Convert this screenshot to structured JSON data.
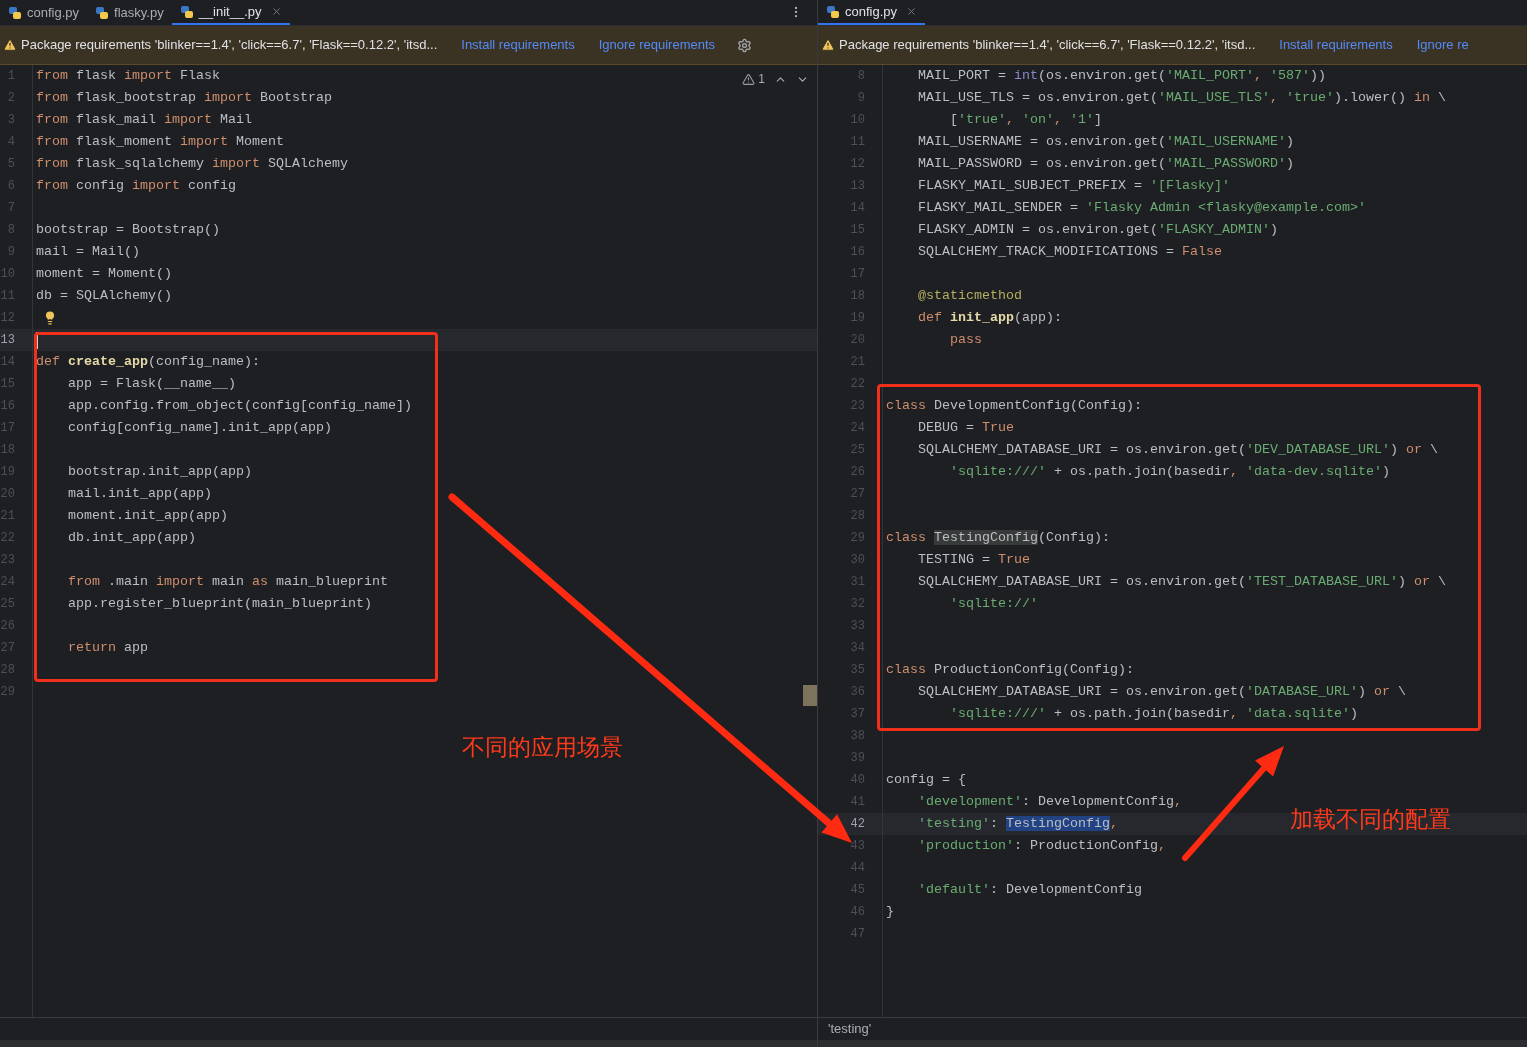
{
  "panes": [
    {
      "tabs": [
        {
          "label": "config.py",
          "selected": false
        },
        {
          "label": "flasky.py",
          "selected": false
        },
        {
          "label": "__init__.py",
          "selected": true
        }
      ],
      "banner": {
        "message": "Package requirements 'blinker==1.4', 'click==6.7', 'Flask==0.12.2', 'itsd...",
        "actions": [
          "Install requirements",
          "Ignore requirements"
        ],
        "settings": true
      },
      "inspections": {
        "count": "1"
      },
      "caret": true,
      "lines": [
        {
          "n": "1",
          "current": false,
          "segs": [
            {
              "text": "from",
              "kind": "kw"
            },
            {
              "text": " flask ",
              "kind": "plain"
            },
            {
              "text": "import",
              "kind": "kw"
            },
            {
              "text": " Flask",
              "kind": "plain"
            }
          ]
        },
        {
          "n": "2",
          "current": false,
          "segs": [
            {
              "text": "from",
              "kind": "kw"
            },
            {
              "text": " flask_bootstrap ",
              "kind": "plain"
            },
            {
              "text": "import",
              "kind": "kw"
            },
            {
              "text": " Bootstrap",
              "kind": "plain"
            }
          ]
        },
        {
          "n": "3",
          "current": false,
          "segs": [
            {
              "text": "from",
              "kind": "kw"
            },
            {
              "text": " flask_mail ",
              "kind": "plain"
            },
            {
              "text": "import",
              "kind": "kw"
            },
            {
              "text": " Mail",
              "kind": "plain"
            }
          ]
        },
        {
          "n": "4",
          "current": false,
          "segs": [
            {
              "text": "from",
              "kind": "kw"
            },
            {
              "text": " flask_moment ",
              "kind": "plain"
            },
            {
              "text": "import",
              "kind": "kw"
            },
            {
              "text": " Moment",
              "kind": "plain"
            }
          ]
        },
        {
          "n": "5",
          "current": false,
          "segs": [
            {
              "text": "from",
              "kind": "kw"
            },
            {
              "text": " flask_sqlalchemy ",
              "kind": "plain"
            },
            {
              "text": "import",
              "kind": "kw"
            },
            {
              "text": " SQLAlchemy",
              "kind": "plain"
            }
          ]
        },
        {
          "n": "6",
          "current": false,
          "segs": [
            {
              "text": "from",
              "kind": "kw"
            },
            {
              "text": " config ",
              "kind": "plain"
            },
            {
              "text": "import",
              "kind": "kw"
            },
            {
              "text": " config",
              "kind": "plain"
            }
          ]
        },
        {
          "n": "7",
          "current": false
        },
        {
          "n": "8",
          "current": false,
          "segs": [
            {
              "text": "bootstrap = Bootstrap()",
              "kind": "plain"
            }
          ]
        },
        {
          "n": "9",
          "current": false,
          "segs": [
            {
              "text": "mail = Mail()",
              "kind": "plain"
            }
          ]
        },
        {
          "n": "10",
          "current": false,
          "segs": [
            {
              "text": "moment = Moment()",
              "kind": "plain"
            }
          ]
        },
        {
          "n": "11",
          "current": false,
          "segs": [
            {
              "text": "db = SQLAlchemy()",
              "kind": "plain"
            }
          ]
        },
        {
          "n": "12",
          "current": false,
          "hint": true
        },
        {
          "n": "13",
          "current": true
        },
        {
          "n": "14",
          "current": false,
          "segs": [
            {
              "text": "def ",
              "kind": "kw"
            },
            {
              "text": "create_app",
              "kind": "fn"
            },
            {
              "text": "(config_name):",
              "kind": "plain"
            }
          ]
        },
        {
          "n": "15",
          "current": false,
          "segs": [
            {
              "text": "    app = Flask(__name__)",
              "kind": "plain"
            }
          ]
        },
        {
          "n": "16",
          "current": false,
          "segs": [
            {
              "text": "    app.config.from_object(config[config_name])",
              "kind": "plain"
            }
          ]
        },
        {
          "n": "17",
          "current": false,
          "segs": [
            {
              "text": "    config[config_name].init_app(app)",
              "kind": "plain"
            }
          ]
        },
        {
          "n": "18",
          "current": false
        },
        {
          "n": "19",
          "current": false,
          "segs": [
            {
              "text": "    bootstrap.init_app(app)",
              "kind": "plain"
            }
          ]
        },
        {
          "n": "20",
          "current": false,
          "segs": [
            {
              "text": "    mail.init_app(app)",
              "kind": "plain"
            }
          ]
        },
        {
          "n": "21",
          "current": false,
          "segs": [
            {
              "text": "    moment.init_app(app)",
              "kind": "plain"
            }
          ]
        },
        {
          "n": "22",
          "current": false,
          "segs": [
            {
              "text": "    db.init_app(app)",
              "kind": "plain"
            }
          ]
        },
        {
          "n": "23",
          "current": false
        },
        {
          "n": "24",
          "current": false,
          "segs": [
            {
              "text": "    from",
              "kind": "kw"
            },
            {
              "text": " .main ",
              "kind": "plain"
            },
            {
              "text": "import",
              "kind": "kw"
            },
            {
              "text": " main ",
              "kind": "plain"
            },
            {
              "text": "as",
              "kind": "kw"
            },
            {
              "text": " main_blueprint",
              "kind": "plain"
            }
          ]
        },
        {
          "n": "25",
          "current": false,
          "segs": [
            {
              "text": "    app.register_blueprint(main_blueprint)",
              "kind": "plain"
            }
          ]
        },
        {
          "n": "26",
          "current": false
        },
        {
          "n": "27",
          "current": false,
          "segs": [
            {
              "text": "    return",
              "kind": "kw"
            },
            {
              "text": " app",
              "kind": "plain"
            }
          ]
        },
        {
          "n": "28",
          "current": false
        },
        {
          "n": "29",
          "current": false
        }
      ]
    },
    {
      "tabs": [
        {
          "label": "config.py",
          "selected": true
        }
      ],
      "banner": {
        "message": "Package requirements 'blinker==1.4', 'click==6.7', 'Flask==0.12.2', 'itsd...",
        "actions": [
          "Install requirements",
          "Ignore re"
        ]
      },
      "lines": [
        {
          "n": "8",
          "current": false,
          "segs": [
            {
              "text": "    MAIL_PORT = ",
              "kind": "plain"
            },
            {
              "text": "int",
              "kind": "builtin"
            },
            {
              "text": "(os.environ.get(",
              "kind": "plain"
            },
            {
              "text": "'MAIL_PORT'",
              "kind": "str"
            },
            {
              "text": ", ",
              "kind": "comma"
            },
            {
              "text": "'587'",
              "kind": "str"
            },
            {
              "text": "))",
              "kind": "plain"
            }
          ]
        },
        {
          "n": "9",
          "current": false,
          "segs": [
            {
              "text": "    MAIL_USE_TLS = os.environ.get(",
              "kind": "plain"
            },
            {
              "text": "'MAIL_USE_TLS'",
              "kind": "str"
            },
            {
              "text": ", ",
              "kind": "comma"
            },
            {
              "text": "'true'",
              "kind": "str"
            },
            {
              "text": ").lower() ",
              "kind": "plain"
            },
            {
              "text": "in",
              "kind": "kw"
            },
            {
              "text": " \\",
              "kind": "plain"
            }
          ]
        },
        {
          "n": "10",
          "current": false,
          "segs": [
            {
              "text": "        [",
              "kind": "plain"
            },
            {
              "text": "'true'",
              "kind": "str"
            },
            {
              "text": ", ",
              "kind": "comma"
            },
            {
              "text": "'on'",
              "kind": "str"
            },
            {
              "text": ", ",
              "kind": "comma"
            },
            {
              "text": "'1'",
              "kind": "str"
            },
            {
              "text": "]",
              "kind": "plain"
            }
          ]
        },
        {
          "n": "11",
          "current": false,
          "segs": [
            {
              "text": "    MAIL_USERNAME = os.environ.get(",
              "kind": "plain"
            },
            {
              "text": "'MAIL_USERNAME'",
              "kind": "str"
            },
            {
              "text": ")",
              "kind": "plain"
            }
          ]
        },
        {
          "n": "12",
          "current": false,
          "segs": [
            {
              "text": "    MAIL_PASSWORD = os.environ.get(",
              "kind": "plain"
            },
            {
              "text": "'MAIL_PASSWORD'",
              "kind": "str"
            },
            {
              "text": ")",
              "kind": "plain"
            }
          ]
        },
        {
          "n": "13",
          "current": false,
          "segs": [
            {
              "text": "    FLASKY_MAIL_SUBJECT_PREFIX = ",
              "kind": "plain"
            },
            {
              "text": "'[Flasky]'",
              "kind": "str"
            }
          ]
        },
        {
          "n": "14",
          "current": false,
          "segs": [
            {
              "text": "    FLASKY_MAIL_SENDER = ",
              "kind": "plain"
            },
            {
              "text": "'Flasky Admin <flasky@example.com>'",
              "kind": "str"
            }
          ]
        },
        {
          "n": "15",
          "current": false,
          "segs": [
            {
              "text": "    FLASKY_ADMIN = os.environ.get(",
              "kind": "plain"
            },
            {
              "text": "'FLASKY_ADMIN'",
              "kind": "str"
            },
            {
              "text": ")",
              "kind": "plain"
            }
          ]
        },
        {
          "n": "16",
          "current": false,
          "segs": [
            {
              "text": "    SQLALCHEMY_TRACK_MODIFICATIONS = ",
              "kind": "plain"
            },
            {
              "text": "False",
              "kind": "kw"
            }
          ]
        },
        {
          "n": "17",
          "current": false
        },
        {
          "n": "18",
          "current": false,
          "segs": [
            {
              "text": "    @staticmethod",
              "kind": "deco"
            }
          ]
        },
        {
          "n": "19",
          "current": false,
          "segs": [
            {
              "text": "    def ",
              "kind": "kw"
            },
            {
              "text": "init_app",
              "kind": "fn"
            },
            {
              "text": "(app):",
              "kind": "plain"
            }
          ]
        },
        {
          "n": "20",
          "current": false,
          "segs": [
            {
              "text": "        pass",
              "kind": "kw"
            }
          ]
        },
        {
          "n": "21",
          "current": false
        },
        {
          "n": "22",
          "current": false
        },
        {
          "n": "23",
          "current": false,
          "segs": [
            {
              "text": "class",
              "kind": "kw"
            },
            {
              "text": " DevelopmentConfig(Config):",
              "kind": "plain"
            }
          ]
        },
        {
          "n": "24",
          "current": false,
          "segs": [
            {
              "text": "    DEBUG = ",
              "kind": "plain"
            },
            {
              "text": "True",
              "kind": "kw"
            }
          ]
        },
        {
          "n": "25",
          "current": false,
          "segs": [
            {
              "text": "    SQLALCHEMY_DATABASE_URI = os.environ.get(",
              "kind": "plain"
            },
            {
              "text": "'DEV_DATABASE_URL'",
              "kind": "str"
            },
            {
              "text": ") ",
              "kind": "plain"
            },
            {
              "text": "or",
              "kind": "kw"
            },
            {
              "text": " \\",
              "kind": "plain"
            }
          ]
        },
        {
          "n": "26",
          "current": false,
          "segs": [
            {
              "text": "        'sqlite:///'",
              "kind": "str"
            },
            {
              "text": " + os.path.join(basedir",
              "kind": "plain"
            },
            {
              "text": ", ",
              "kind": "comma"
            },
            {
              "text": "'data-dev.sqlite'",
              "kind": "str"
            },
            {
              "text": ")",
              "kind": "plain"
            }
          ]
        },
        {
          "n": "27",
          "current": false
        },
        {
          "n": "28",
          "current": false
        },
        {
          "n": "29",
          "current": false,
          "segs": [
            {
              "text": "class ",
              "kind": "kw"
            },
            {
              "text": "TestingConfig",
              "kind": "usage"
            },
            {
              "text": "(Config):",
              "kind": "plain"
            }
          ]
        },
        {
          "n": "30",
          "current": false,
          "segs": [
            {
              "text": "    TESTING = ",
              "kind": "plain"
            },
            {
              "text": "True",
              "kind": "kw"
            }
          ]
        },
        {
          "n": "31",
          "current": false,
          "segs": [
            {
              "text": "    SQLALCHEMY_DATABASE_URI = os.environ.get(",
              "kind": "plain"
            },
            {
              "text": "'TEST_DATABASE_URL'",
              "kind": "str"
            },
            {
              "text": ") ",
              "kind": "plain"
            },
            {
              "text": "or",
              "kind": "kw"
            },
            {
              "text": " \\",
              "kind": "plain"
            }
          ]
        },
        {
          "n": "32",
          "current": false,
          "segs": [
            {
              "text": "        'sqlite://'",
              "kind": "str"
            }
          ]
        },
        {
          "n": "33",
          "current": false
        },
        {
          "n": "34",
          "current": false
        },
        {
          "n": "35",
          "current": false,
          "segs": [
            {
              "text": "class",
              "kind": "kw"
            },
            {
              "text": " ProductionConfig(Config):",
              "kind": "plain"
            }
          ]
        },
        {
          "n": "36",
          "current": false,
          "segs": [
            {
              "text": "    SQLALCHEMY_DATABASE_URI = os.environ.get(",
              "kind": "plain"
            },
            {
              "text": "'DATABASE_URL'",
              "kind": "str"
            },
            {
              "text": ") ",
              "kind": "plain"
            },
            {
              "text": "or",
              "kind": "kw"
            },
            {
              "text": " \\",
              "kind": "plain"
            }
          ]
        },
        {
          "n": "37",
          "current": false,
          "segs": [
            {
              "text": "        'sqlite:///'",
              "kind": "str"
            },
            {
              "text": " + os.path.join(basedir",
              "kind": "plain"
            },
            {
              "text": ", ",
              "kind": "comma"
            },
            {
              "text": "'data.sqlite'",
              "kind": "str"
            },
            {
              "text": ")",
              "kind": "plain"
            }
          ]
        },
        {
          "n": "38",
          "current": false
        },
        {
          "n": "39",
          "current": false
        },
        {
          "n": "40",
          "current": false,
          "segs": [
            {
              "text": "config = {",
              "kind": "plain"
            }
          ]
        },
        {
          "n": "41",
          "current": false,
          "segs": [
            {
              "text": "    'development'",
              "kind": "str"
            },
            {
              "text": ": DevelopmentConfig",
              "kind": "plain"
            },
            {
              "text": ",",
              "kind": "comma"
            }
          ]
        },
        {
          "n": "42",
          "current": true,
          "segs": [
            {
              "text": "    'testing'",
              "kind": "str"
            },
            {
              "text": ": ",
              "kind": "plain"
            },
            {
              "text": "TestingConfig",
              "kind": "selection"
            },
            {
              "text": ",",
              "kind": "comma"
            }
          ]
        },
        {
          "n": "43",
          "current": false,
          "segs": [
            {
              "text": "    'production'",
              "kind": "str"
            },
            {
              "text": ": ProductionConfig",
              "kind": "plain"
            },
            {
              "text": ",",
              "kind": "comma"
            }
          ]
        },
        {
          "n": "44",
          "current": false
        },
        {
          "n": "45",
          "current": false,
          "segs": [
            {
              "text": "    'default'",
              "kind": "str"
            },
            {
              "text": ": DevelopmentConfig",
              "kind": "plain"
            }
          ]
        },
        {
          "n": "46",
          "current": false,
          "segs": [
            {
              "text": "}",
              "kind": "plain"
            }
          ]
        },
        {
          "n": "47",
          "current": false
        }
      ],
      "status": "'testing'"
    }
  ],
  "annotations": [
    {
      "text": "不同的应用场景"
    },
    {
      "text": "加载不同的配置"
    }
  ]
}
